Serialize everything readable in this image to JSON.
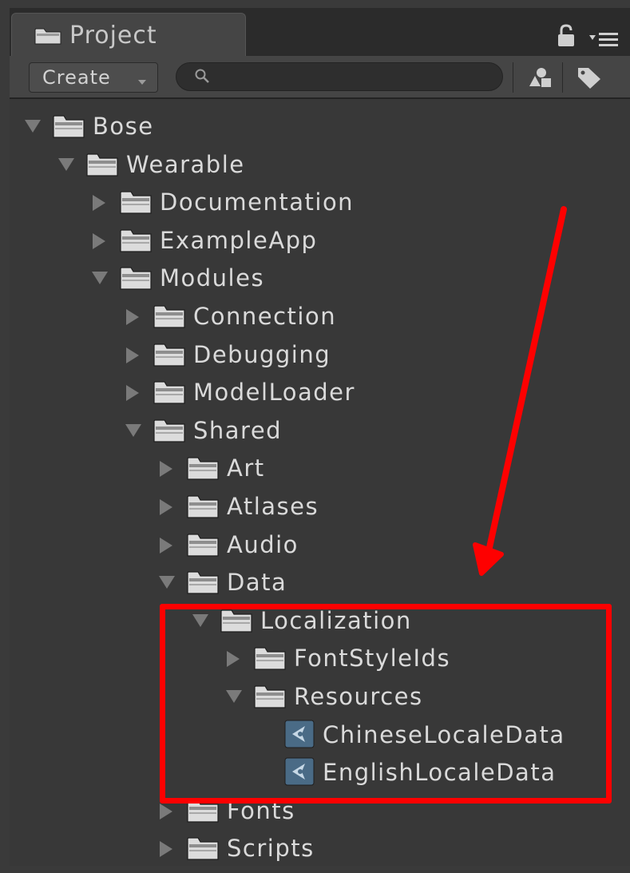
{
  "window": {
    "tab_label": "Project",
    "lock_icon": "lock-icon",
    "menu_icon": "menu-icon"
  },
  "toolbar": {
    "create_label": "Create",
    "search_placeholder": "",
    "search_value": ""
  },
  "tree": [
    {
      "label": "Bose",
      "depth": 0,
      "state": "expanded",
      "kind": "folder"
    },
    {
      "label": "Wearable",
      "depth": 1,
      "state": "expanded",
      "kind": "folder"
    },
    {
      "label": "Documentation",
      "depth": 2,
      "state": "collapsed",
      "kind": "folder"
    },
    {
      "label": "ExampleApp",
      "depth": 2,
      "state": "collapsed",
      "kind": "folder"
    },
    {
      "label": "Modules",
      "depth": 2,
      "state": "expanded",
      "kind": "folder"
    },
    {
      "label": "Connection",
      "depth": 3,
      "state": "collapsed",
      "kind": "folder"
    },
    {
      "label": "Debugging",
      "depth": 3,
      "state": "collapsed",
      "kind": "folder"
    },
    {
      "label": "ModelLoader",
      "depth": 3,
      "state": "collapsed",
      "kind": "folder"
    },
    {
      "label": "Shared",
      "depth": 3,
      "state": "expanded",
      "kind": "folder"
    },
    {
      "label": "Art",
      "depth": 4,
      "state": "collapsed",
      "kind": "folder"
    },
    {
      "label": "Atlases",
      "depth": 4,
      "state": "collapsed",
      "kind": "folder"
    },
    {
      "label": "Audio",
      "depth": 4,
      "state": "collapsed",
      "kind": "folder"
    },
    {
      "label": "Data",
      "depth": 4,
      "state": "expanded",
      "kind": "folder"
    },
    {
      "label": "Localization",
      "depth": 5,
      "state": "expanded",
      "kind": "folder"
    },
    {
      "label": "FontStyleIds",
      "depth": 6,
      "state": "collapsed",
      "kind": "folder"
    },
    {
      "label": "Resources",
      "depth": 6,
      "state": "expanded",
      "kind": "folder"
    },
    {
      "label": "ChineseLocaleData",
      "depth": 7,
      "state": "leaf",
      "kind": "asset"
    },
    {
      "label": "EnglishLocaleData",
      "depth": 7,
      "state": "leaf",
      "kind": "asset"
    },
    {
      "label": "Fonts",
      "depth": 4,
      "state": "collapsed",
      "kind": "folder"
    },
    {
      "label": "Scripts",
      "depth": 4,
      "state": "collapsed",
      "kind": "folder"
    }
  ],
  "colors": {
    "background": "#383838",
    "text": "#dadada",
    "annotation": "#fe0000"
  }
}
